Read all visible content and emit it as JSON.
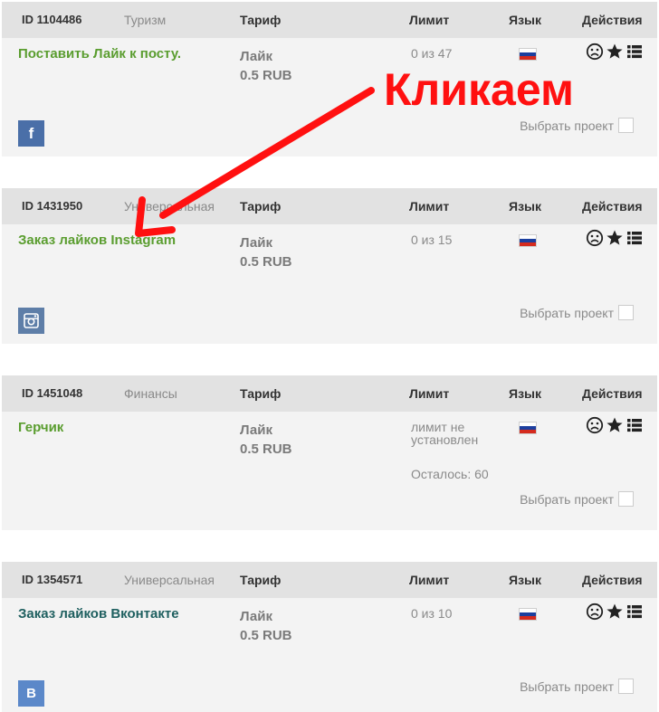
{
  "header_labels": {
    "tariff": "Тариф",
    "limit": "Лимит",
    "language": "Язык",
    "actions": "Действия"
  },
  "choose_label": "Выбрать проект",
  "annotation": "Кликаем",
  "colors": {
    "title_green": "#5a9d2f",
    "title_teal": "#1e5f5f",
    "annotation_red": "#ff1010",
    "header_bg": "#e2e2e2",
    "card_bg": "#f3f3f3"
  },
  "cards": [
    {
      "id": "ID 1104486",
      "category": "Туризм",
      "title": "Поставить Лайк к посту.",
      "tariff_type": "Лайк",
      "tariff_price": "0.5 RUB",
      "limit": "0 из 47",
      "remaining": "",
      "language_flag": "russia-flag-icon",
      "social": "f",
      "social_icon": "facebook-icon"
    },
    {
      "id": "ID 1431950",
      "category": "Универсальная",
      "title": "Заказ лайков Instagram",
      "tariff_type": "Лайк",
      "tariff_price": "0.5 RUB",
      "limit": "0 из 15",
      "remaining": "",
      "language_flag": "russia-flag-icon",
      "social": "",
      "social_icon": "instagram-icon"
    },
    {
      "id": "ID 1451048",
      "category": "Финансы",
      "title": "Герчик",
      "tariff_type": "Лайк",
      "tariff_price": "0.5 RUB",
      "limit": "лимит не установлен",
      "remaining": "Осталось: 60",
      "language_flag": "russia-flag-icon",
      "social": "",
      "social_icon": ""
    },
    {
      "id": "ID 1354571",
      "category": "Универсальная",
      "title": "Заказ лайков Вконтакте",
      "tariff_type": "Лайк",
      "tariff_price": "0.5 RUB",
      "limit": "0 из 10",
      "remaining": "",
      "language_flag": "russia-flag-icon",
      "social": "В",
      "social_icon": "vk-icon"
    }
  ]
}
